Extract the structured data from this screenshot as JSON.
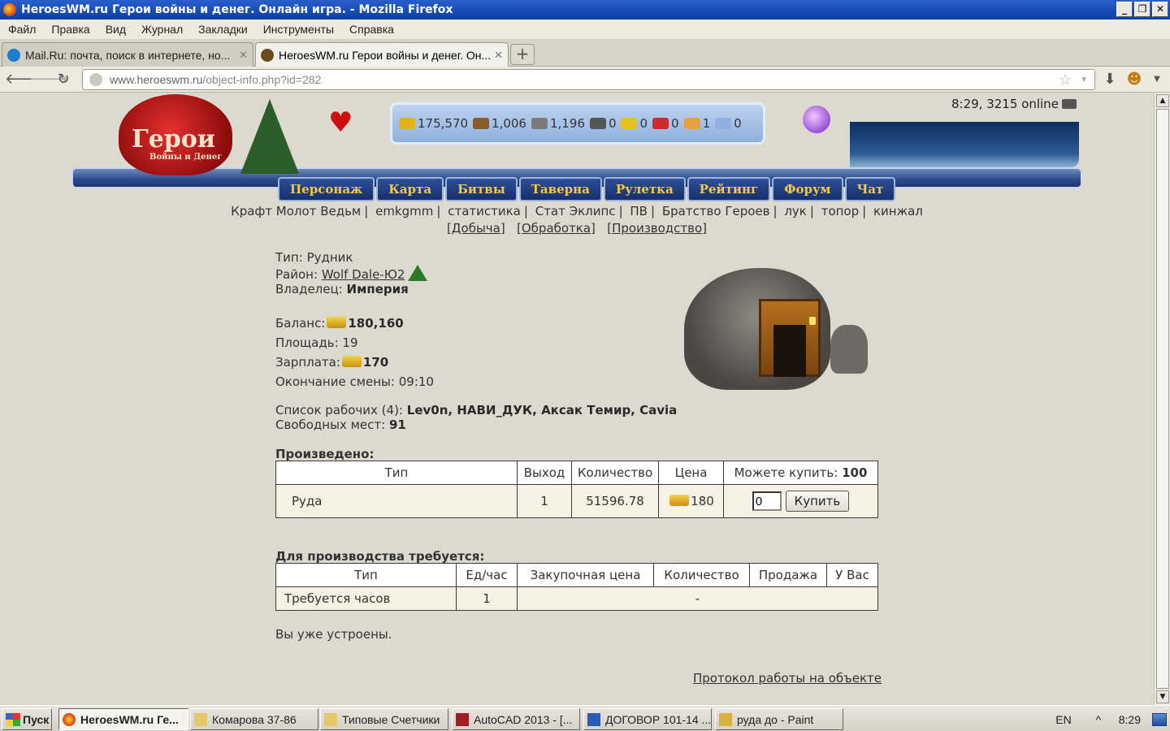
{
  "window": {
    "title": "HeroesWM.ru Герои войны и денег. Онлайн игра. - Mozilla Firefox",
    "buttons": [
      "_",
      "❐",
      "✕"
    ]
  },
  "menu": [
    "Файл",
    "Правка",
    "Вид",
    "Журнал",
    "Закладки",
    "Инструменты",
    "Справка"
  ],
  "tabs": [
    {
      "label": "Mail.Ru: почта, поиск в интернете, но...",
      "active": false,
      "icon_color": "#1a7fd0"
    },
    {
      "label": "HeroesWM.ru Герои войны и денег. Он...",
      "active": true,
      "icon_color": "#6b4a1e"
    }
  ],
  "url": {
    "host": "www.heroeswm.ru",
    "path": "/object-info.php?id=282"
  },
  "header": {
    "logo": "Герои",
    "logo_sub": "Войны и Денег",
    "time_online": "8:29, 3215 online",
    "resources": [
      {
        "name": "gold",
        "value": "175,570",
        "color": "#e0b21c"
      },
      {
        "name": "wood",
        "value": "1,006",
        "color": "#8a5a2b"
      },
      {
        "name": "ore",
        "value": "1,196",
        "color": "#7a7a7a"
      },
      {
        "name": "mercury",
        "value": "0",
        "color": "#555555"
      },
      {
        "name": "sulfur",
        "value": "0",
        "color": "#e8c020"
      },
      {
        "name": "crystal",
        "value": "0",
        "color": "#d02a2a"
      },
      {
        "name": "gems",
        "value": "1",
        "color": "#e8a040"
      },
      {
        "name": "diamonds",
        "value": "0",
        "color": "#8fb0e0"
      }
    ],
    "nav": [
      "Персонаж",
      "Карта",
      "Битвы",
      "Таверна",
      "Рулетка",
      "Рейтинг",
      "Форум",
      "Чат"
    ]
  },
  "quicklinks": [
    "Крафт Молот Ведьм",
    "emkgmm",
    "статистика",
    "Стат Эклипс",
    "ПВ",
    "Братство Героев",
    "лук",
    "топор",
    "кинжал"
  ],
  "sublinks": [
    "[Добыча]",
    "[Обработка]",
    "[Производство]"
  ],
  "object": {
    "type_label": "Тип:",
    "type": "Рудник",
    "district_label": "Район:",
    "district": "Wolf Dale-Ю2",
    "owner_label": "Владелец:",
    "owner": "Империя",
    "balance_label": "Баланс:",
    "balance": "180,160",
    "area_label": "Площадь:",
    "area": "19",
    "salary_label": "Зарплата:",
    "salary": "170",
    "shift_label": "Окончание смены:",
    "shift_end": "09:10",
    "workers_label": "Список рабочих (4):",
    "workers": "Lev0n, НАВИ_ДУК, Аксак Темир, Cavia",
    "free_label": "Свободных мест:",
    "free_places": "91"
  },
  "produced": {
    "title": "Произведено:",
    "headers": [
      "Тип",
      "Выход",
      "Количество",
      "Цена",
      "Можете купить:"
    ],
    "can_buy": "100",
    "row": {
      "type": "Руда",
      "output": "1",
      "quantity": "51596.78",
      "price": "180",
      "input_value": "0",
      "buy_label": "Купить"
    }
  },
  "required": {
    "title": "Для производства требуется:",
    "headers": [
      "Тип",
      "Ед/час",
      "Закупочная цена",
      "Количество",
      "Продажа",
      "У Вас"
    ],
    "row": {
      "type": "Требуется часов",
      "per_hour": "1",
      "rest": "-"
    }
  },
  "status_text": "Вы уже устроены.",
  "protocol_link": "Протокол работы на объекте",
  "taskbar": {
    "start": "Пуск",
    "items": [
      {
        "label": "HeroesWM.ru Ге...",
        "active": true
      },
      {
        "label": "Комарова 37-86",
        "active": false
      },
      {
        "label": "Типовые Счетчики",
        "active": false
      },
      {
        "label": "AutoCAD 2013 - [...",
        "active": false
      },
      {
        "label": "ДОГОВОР 101-14 ...",
        "active": false
      },
      {
        "label": "руда до - Paint",
        "active": false
      }
    ],
    "lang": "EN",
    "clock": "8:29"
  }
}
